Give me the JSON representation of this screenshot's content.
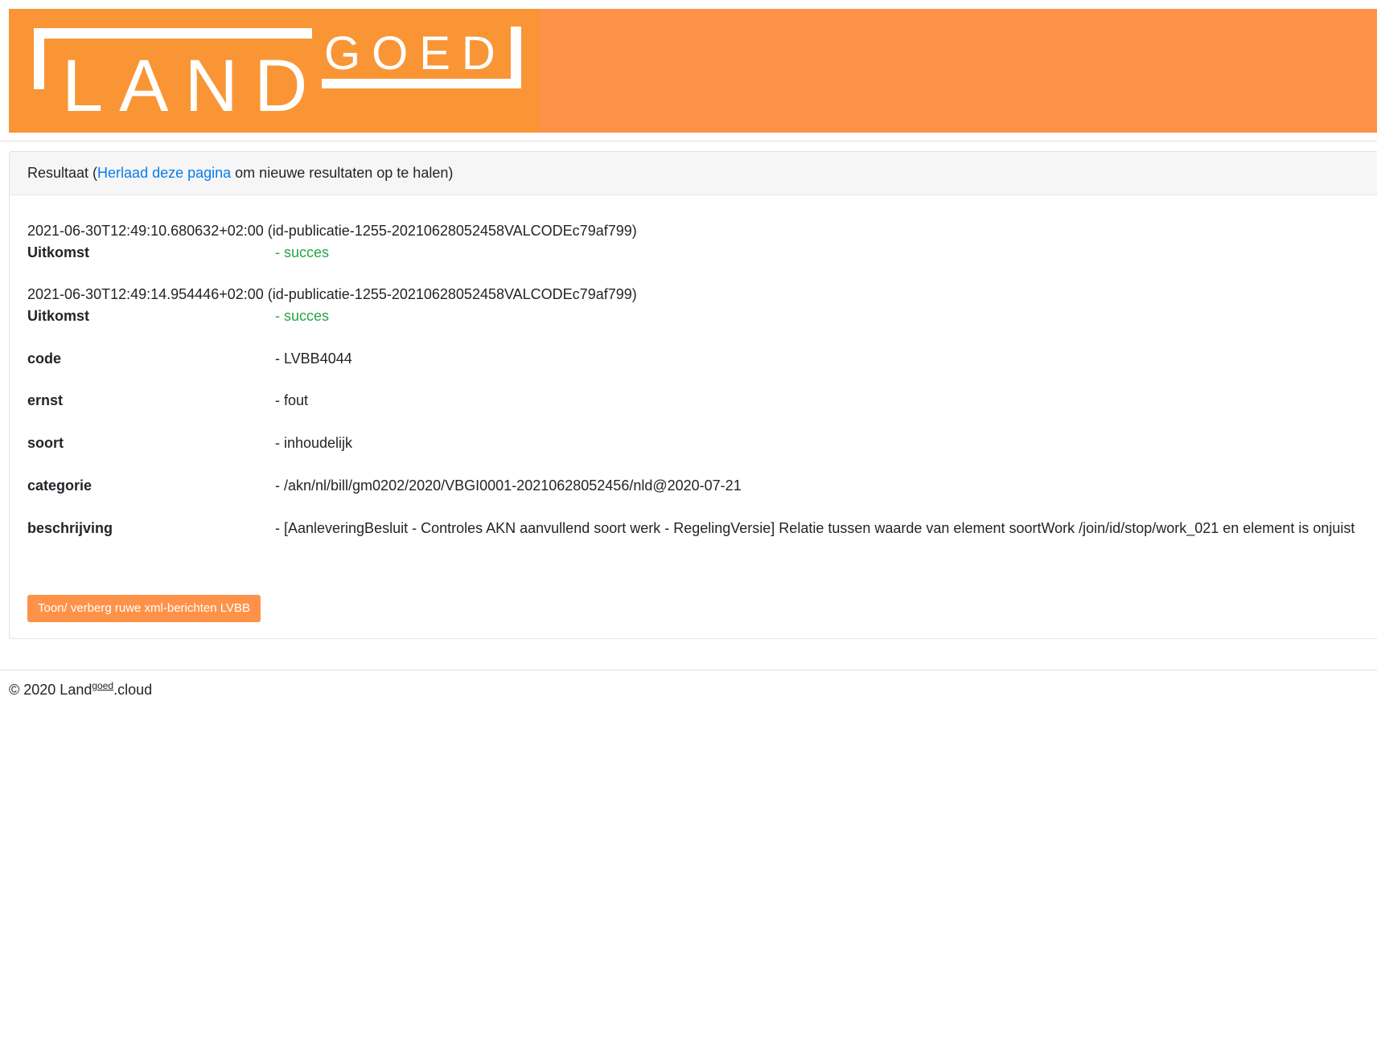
{
  "header": {
    "logo": {
      "word_main": "LAND",
      "word_super": "GOED"
    },
    "colors": {
      "header_bg": "#ff9249",
      "logo_bg": "#f99534",
      "logo_fg": "#ffffff"
    }
  },
  "result": {
    "title_prefix": "Resultaat (",
    "reload_link": "Herlaad deze pagina",
    "title_suffix": " om nieuwe resultaten op te halen)",
    "entries": [
      {
        "timestamp": "2021-06-30T12:49:10.680632+02:00 (id-publicatie-1255-20210628052458VALCODEc79af799)",
        "outcome_label": "Uitkomst",
        "outcome_value": "- succes"
      },
      {
        "timestamp": "2021-06-30T12:49:14.954446+02:00 (id-publicatie-1255-20210628052458VALCODEc79af799)",
        "outcome_label": "Uitkomst",
        "outcome_value": "- succes"
      }
    ],
    "details": [
      {
        "label": "code",
        "value": "- LVBB4044"
      },
      {
        "label": "ernst",
        "value": "- fout"
      },
      {
        "label": "soort",
        "value": "- inhoudelijk"
      },
      {
        "label": "categorie",
        "value": "- /akn/nl/bill/gm0202/2020/VBGI0001-20210628052456/nld@2020-07-21"
      },
      {
        "label": "beschrijving",
        "value": "- [AanleveringBesluit - Controles AKN aanvullend soort werk - RegelingVersie] Relatie tussen waarde van element soortWork /join/id/stop/work_021 en element is onjuist"
      }
    ],
    "toggle_button": "Toon/ verberg ruwe xml-berichten LVBB",
    "colors": {
      "link": "#0a7bef",
      "success": "#27a545",
      "button_bg": "#ff9249"
    }
  },
  "footer": {
    "copyright": "© 2020 Land",
    "superscript": "goed",
    "suffix": ".cloud"
  }
}
